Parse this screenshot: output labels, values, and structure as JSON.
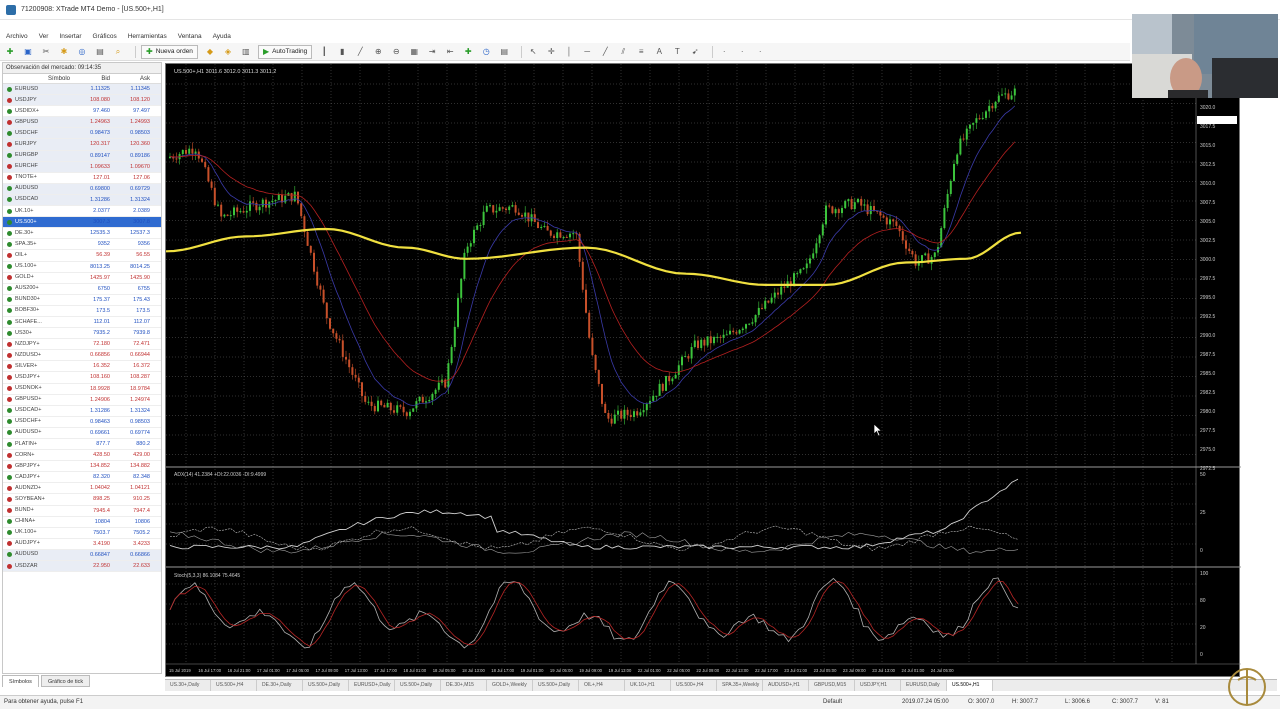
{
  "window": {
    "title": "71200908: XTrade MT4 Demo - [US.500+,H1]"
  },
  "menu": [
    "Archivo",
    "Ver",
    "Insertar",
    "Gráficos",
    "Herramientas",
    "Ventana",
    "Ayuda"
  ],
  "toolbar": {
    "new_order": "Nueva orden",
    "autotrading": "AutoTrading"
  },
  "market_watch": {
    "title": "Observación del mercado: 09:14:35",
    "headers": {
      "symbol": "Símbolo",
      "bid": "Bid",
      "ask": "Ask"
    },
    "rows": [
      {
        "symbol": "EURUSD",
        "bid": "1.11325",
        "ask": "1.11345",
        "color": "#2e8b2e",
        "faded": true
      },
      {
        "symbol": "USDJPY",
        "bid": "108.080",
        "ask": "108.120",
        "color": "#c03030",
        "faded": true
      },
      {
        "symbol": "USDIDX+",
        "bid": "97.460",
        "ask": "97.497",
        "color": "#2e8b2e",
        "faded": false
      },
      {
        "symbol": "GBPUSD",
        "bid": "1.24963",
        "ask": "1.24993",
        "color": "#c03030",
        "faded": true
      },
      {
        "symbol": "USDCHF",
        "bid": "0.98473",
        "ask": "0.98503",
        "color": "#2e8b2e",
        "faded": true
      },
      {
        "symbol": "EURJPY",
        "bid": "120.317",
        "ask": "120.360",
        "color": "#c03030",
        "faded": true
      },
      {
        "symbol": "EURGBP",
        "bid": "0.89147",
        "ask": "0.89186",
        "color": "#2e8b2e",
        "faded": true
      },
      {
        "symbol": "EURCHF",
        "bid": "1.09633",
        "ask": "1.09670",
        "color": "#c03030",
        "faded": true
      },
      {
        "symbol": "TNOTE+",
        "bid": "127.01",
        "ask": "127.06",
        "color": "#c03030",
        "faded": false
      },
      {
        "symbol": "AUDUSD",
        "bid": "0.69800",
        "ask": "0.69729",
        "color": "#2e8b2e",
        "faded": true
      },
      {
        "symbol": "USDCAD",
        "bid": "1.31286",
        "ask": "1.31324",
        "color": "#2e8b2e",
        "faded": true
      },
      {
        "symbol": "UK.10+",
        "bid": "2.0377",
        "ask": "2.0389",
        "color": "#2e8b2e",
        "faded": false
      },
      {
        "symbol": "US.500+",
        "bid": "3007.3",
        "ask": "3007.8",
        "color": "#2e8b2e",
        "faded": false,
        "selected": true
      },
      {
        "symbol": "DE.30+",
        "bid": "12535.3",
        "ask": "12537.3",
        "color": "#2e8b2e",
        "faded": false
      },
      {
        "symbol": "SPA.35+",
        "bid": "9352",
        "ask": "9356",
        "color": "#2e8b2e",
        "faded": false
      },
      {
        "symbol": "OIL+",
        "bid": "56.39",
        "ask": "56.55",
        "color": "#c03030",
        "faded": false
      },
      {
        "symbol": "US.100+",
        "bid": "8013.25",
        "ask": "8014.25",
        "color": "#2e8b2e",
        "faded": false
      },
      {
        "symbol": "GOLD+",
        "bid": "1425.97",
        "ask": "1425.90",
        "color": "#c03030",
        "faded": false
      },
      {
        "symbol": "AUS200+",
        "bid": "6750",
        "ask": "6755",
        "color": "#2e8b2e",
        "faded": false
      },
      {
        "symbol": "BUND30+",
        "bid": "175.37",
        "ask": "175.43",
        "color": "#2e8b2e",
        "faded": false
      },
      {
        "symbol": "BOBF30+",
        "bid": "173.5",
        "ask": "173.5",
        "color": "#2e8b2e",
        "faded": false
      },
      {
        "symbol": "SCHAFE...",
        "bid": "112.01",
        "ask": "112.07",
        "color": "#2e8b2e",
        "faded": false
      },
      {
        "symbol": "US30+",
        "bid": "7935.2",
        "ask": "7939.8",
        "color": "#2e8b2e",
        "faded": false
      },
      {
        "symbol": "NZDJPY+",
        "bid": "72.180",
        "ask": "72.471",
        "color": "#c03030",
        "faded": false
      },
      {
        "symbol": "NZDUSD+",
        "bid": "0.66856",
        "ask": "0.66944",
        "color": "#c03030",
        "faded": false
      },
      {
        "symbol": "SILVER+",
        "bid": "16.352",
        "ask": "16.372",
        "color": "#c03030",
        "faded": false
      },
      {
        "symbol": "USDJPY+",
        "bid": "108.160",
        "ask": "108.287",
        "color": "#c03030",
        "faded": false
      },
      {
        "symbol": "USDNOK+",
        "bid": "18.9928",
        "ask": "18.9784",
        "color": "#c03030",
        "faded": false
      },
      {
        "symbol": "GBPUSD+",
        "bid": "1.24906",
        "ask": "1.24974",
        "color": "#c03030",
        "faded": false
      },
      {
        "symbol": "USDCAD+",
        "bid": "1.31286",
        "ask": "1.31324",
        "color": "#2e8b2e",
        "faded": false
      },
      {
        "symbol": "USDCHF+",
        "bid": "0.98463",
        "ask": "0.98503",
        "color": "#2e8b2e",
        "faded": false
      },
      {
        "symbol": "AUDUSD+",
        "bid": "0.69661",
        "ask": "0.69774",
        "color": "#2e8b2e",
        "faded": false
      },
      {
        "symbol": "PLATIN+",
        "bid": "877.7",
        "ask": "880.2",
        "color": "#2e8b2e",
        "faded": false
      },
      {
        "symbol": "CORN+",
        "bid": "428.50",
        "ask": "429.00",
        "color": "#c03030",
        "faded": false
      },
      {
        "symbol": "GBPJPY+",
        "bid": "134.852",
        "ask": "134.882",
        "color": "#c03030",
        "faded": false
      },
      {
        "symbol": "CADJPY+",
        "bid": "82.320",
        "ask": "82.348",
        "color": "#2e8b2e",
        "faded": false
      },
      {
        "symbol": "AUDNZD+",
        "bid": "1.04042",
        "ask": "1.04121",
        "color": "#c03030",
        "faded": false
      },
      {
        "symbol": "SOYBEAN+",
        "bid": "898.25",
        "ask": "910.25",
        "color": "#c03030",
        "faded": false
      },
      {
        "symbol": "BUND+",
        "bid": "7945.4",
        "ask": "7947.4",
        "color": "#c03030",
        "faded": false
      },
      {
        "symbol": "CHINA+",
        "bid": "10804",
        "ask": "10806",
        "color": "#2e8b2e",
        "faded": false
      },
      {
        "symbol": "UK.100+",
        "bid": "7503.7",
        "ask": "7505.2",
        "color": "#2e8b2e",
        "faded": false
      },
      {
        "symbol": "AUDJPY+",
        "bid": "3.4190",
        "ask": "3.4233",
        "color": "#c03030",
        "faded": false
      },
      {
        "symbol": "AUDUSD",
        "bid": "0.66847",
        "ask": "0.66866",
        "color": "#2e8b2e",
        "faded": true
      },
      {
        "symbol": "USDZAR",
        "bid": "22.950",
        "ask": "22.633",
        "color": "#c03030",
        "faded": true
      }
    ],
    "tabs": [
      "Símbolos",
      "Gráfico de tick"
    ]
  },
  "chart": {
    "header": "US.500+,H1 3011.6 3012.0 3011.3 3011.2",
    "osc1_header": "ADX(14) 41.2384 +DI:22.0036 -DI:9.4999",
    "osc2_header": "Stoch(5,3,3) 86.1084 75.4645",
    "price_labels": [
      "3020.0",
      "3017.5",
      "3015.0",
      "3012.5",
      "3010.0",
      "3007.5",
      "3005.0",
      "3002.5",
      "3000.0",
      "2997.5",
      "2995.0",
      "2992.5",
      "2990.0",
      "2987.5",
      "2985.0",
      "2982.5",
      "2980.0",
      "2977.5",
      "2975.0",
      "2972.5"
    ],
    "osc1_labels": [
      "50",
      "25",
      "0"
    ],
    "osc2_labels": [
      "100",
      "80",
      "20",
      "0"
    ],
    "time_labels": [
      "15 Jul 2019",
      "16 Jul 17:00",
      "16 Jul 21:00",
      "17 Jul 01:00",
      "17 Jul 05:00",
      "17 Jul 09:00",
      "17 Jul 13:00",
      "17 Jul 17:00",
      "18 Jul 01:00",
      "18 Jul 05:00",
      "18 Jul 13:00",
      "18 Jul 17:00",
      "19 Jul 01:00",
      "19 Jul 05:00",
      "19 Jul 09:00",
      "19 Jul 13:00",
      "22 Jul 01:00",
      "22 Jul 05:00",
      "22 Jul 09:00",
      "22 Jul 13:00",
      "22 Jul 17:00",
      "23 Jul 01:00",
      "23 Jul 05:00",
      "23 Jul 09:00",
      "23 Jul 13:00",
      "24 Jul 01:00",
      "24 Jul 05:00"
    ]
  },
  "chart_tabs": [
    "US.30+,Daily",
    "US.500+,H4",
    "DE.30+,Daily",
    "US.500+,Daily",
    "EURUSD+,Daily",
    "US.500+,Daily",
    "DE.30+,M15",
    "GOLD+,Weekly",
    "US.500+,Daily",
    "OIL+,H4",
    "UK.10+,H1",
    "US.500+,H4",
    "SPA.35+,Weekly",
    "AUDUSD+,H1",
    "GBPUSD,M15",
    "USDJPY,H1",
    "EURUSD,Daily",
    "US.500+,H1"
  ],
  "status": {
    "help": "Para obtener ayuda, pulse F1",
    "profile": "Default",
    "datetime": "2019.07.24 05:00",
    "open": "O: 3007.0",
    "high": "H: 3007.7",
    "low": "L: 3006.6",
    "close": "C: 3007.7",
    "volume": "V: 81"
  },
  "colors": {
    "bull": "#3cc43c",
    "bear": "#c8502a",
    "ma_slow": "#f0e040",
    "ma_red": "#b52020",
    "ma_blue": "#3a3aa8",
    "grid": "#7a7a7a"
  },
  "icons": [
    "new-order-icon",
    "autotrading-icon",
    "zoom-in-icon",
    "zoom-out-icon",
    "crosshair-icon",
    "period-icon"
  ]
}
